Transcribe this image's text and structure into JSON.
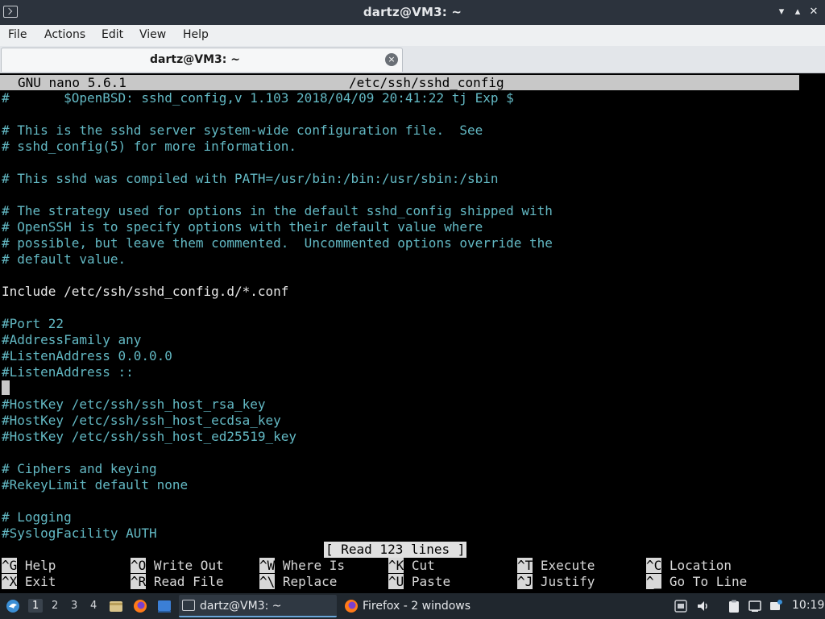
{
  "window": {
    "title": "dartz@VM3: ~",
    "minimize": "▾",
    "maximize": "▴",
    "close": "✕"
  },
  "menu": [
    "File",
    "Actions",
    "Edit",
    "View",
    "Help"
  ],
  "tab": {
    "label": "dartz@VM3: ~",
    "close": "×"
  },
  "nano": {
    "version": "GNU nano 5.6.1",
    "filename": "/etc/ssh/sshd_config",
    "lines": [
      "#\t$OpenBSD: sshd_config,v 1.103 2018/04/09 20:41:22 tj Exp $",
      "",
      "# This is the sshd server system-wide configuration file.  See",
      "# sshd_config(5) for more information.",
      "",
      "# This sshd was compiled with PATH=/usr/bin:/bin:/usr/sbin:/sbin",
      "",
      "# The strategy used for options in the default sshd_config shipped with",
      "# OpenSSH is to specify options with their default value where",
      "# possible, but leave them commented.  Uncommented options override the",
      "# default value.",
      "",
      "Include /etc/ssh/sshd_config.d/*.conf",
      "",
      "#Port 22",
      "#AddressFamily any",
      "#ListenAddress 0.0.0.0",
      "#ListenAddress ::",
      "",
      "#HostKey /etc/ssh/ssh_host_rsa_key",
      "#HostKey /etc/ssh/ssh_host_ecdsa_key",
      "#HostKey /etc/ssh/ssh_host_ed25519_key",
      "",
      "# Ciphers and keying",
      "#RekeyLimit default none",
      "",
      "# Logging",
      "#SyslogFacility AUTH"
    ],
    "status": "[ Read 123 lines ]",
    "shortcuts": [
      {
        "key": "^G",
        "label": "Help"
      },
      {
        "key": "^O",
        "label": "Write Out"
      },
      {
        "key": "^W",
        "label": "Where Is"
      },
      {
        "key": "^K",
        "label": "Cut"
      },
      {
        "key": "^T",
        "label": "Execute"
      },
      {
        "key": "^C",
        "label": "Location"
      },
      {
        "key": "^X",
        "label": "Exit"
      },
      {
        "key": "^R",
        "label": "Read File"
      },
      {
        "key": "^\\",
        "label": "Replace"
      },
      {
        "key": "^U",
        "label": "Paste"
      },
      {
        "key": "^J",
        "label": "Justify"
      },
      {
        "key": "^_",
        "label": "Go To Line"
      }
    ]
  },
  "panel": {
    "workspaces": [
      "1",
      "2",
      "3",
      "4"
    ],
    "active_workspace": "1",
    "tasks": [
      {
        "label": "dartz@VM3: ~",
        "icon": "terminal-icon"
      },
      {
        "label": "Firefox - 2 windows",
        "icon": "firefox-icon"
      }
    ],
    "clock": "10:19"
  },
  "colors": {
    "comment": "#63b9c4",
    "plain": "#e8e8e8",
    "header_bg": "#c8c8c8",
    "panel_bg": "#20272e"
  }
}
